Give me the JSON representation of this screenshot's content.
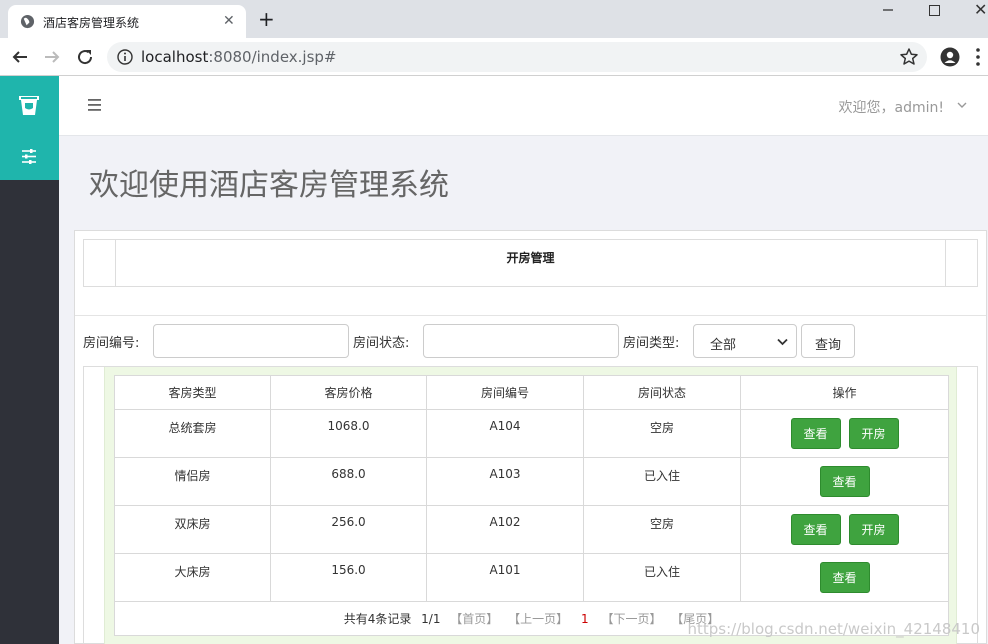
{
  "browser": {
    "tab_title": "酒店客房管理系统",
    "url_host": "localhost",
    "url_path": ":8080/index.jsp#"
  },
  "topbar": {
    "welcome": "欢迎您，admin!"
  },
  "page": {
    "heading": "欢迎使用酒店客房管理系统",
    "panel_title": "开房管理"
  },
  "search": {
    "room_no_label": "房间编号:",
    "room_no_value": "",
    "status_label": "房间状态:",
    "status_value": "",
    "type_label": "房间类型:",
    "type_selected": "全部",
    "query_label": "查询"
  },
  "table": {
    "headers": [
      "客房类型",
      "客房价格",
      "房间编号",
      "房间状态",
      "操作"
    ],
    "rows": [
      {
        "type": "总统套房",
        "price": "1068.0",
        "room_no": "A104",
        "status": "空房",
        "actions": [
          "查看",
          "开房"
        ]
      },
      {
        "type": "情侣房",
        "price": "688.0",
        "room_no": "A103",
        "status": "已入住",
        "actions": [
          "查看"
        ]
      },
      {
        "type": "双床房",
        "price": "256.0",
        "room_no": "A102",
        "status": "空房",
        "actions": [
          "查看",
          "开房"
        ]
      },
      {
        "type": "大床房",
        "price": "156.0",
        "room_no": "A101",
        "status": "已入住",
        "actions": [
          "查看"
        ]
      }
    ]
  },
  "pager": {
    "total": "共有4条记录",
    "pages": "1/1",
    "first": "【首页】",
    "prev": "【上一页】",
    "current": "1",
    "next": "【下一页】",
    "last": "【尾页】"
  },
  "watermark": "https://blog.csdn.net/weixin_42148410",
  "colors": {
    "accent": "#1fb5ac",
    "sidebar": "#2f3139",
    "button_green": "#3fa33f"
  }
}
